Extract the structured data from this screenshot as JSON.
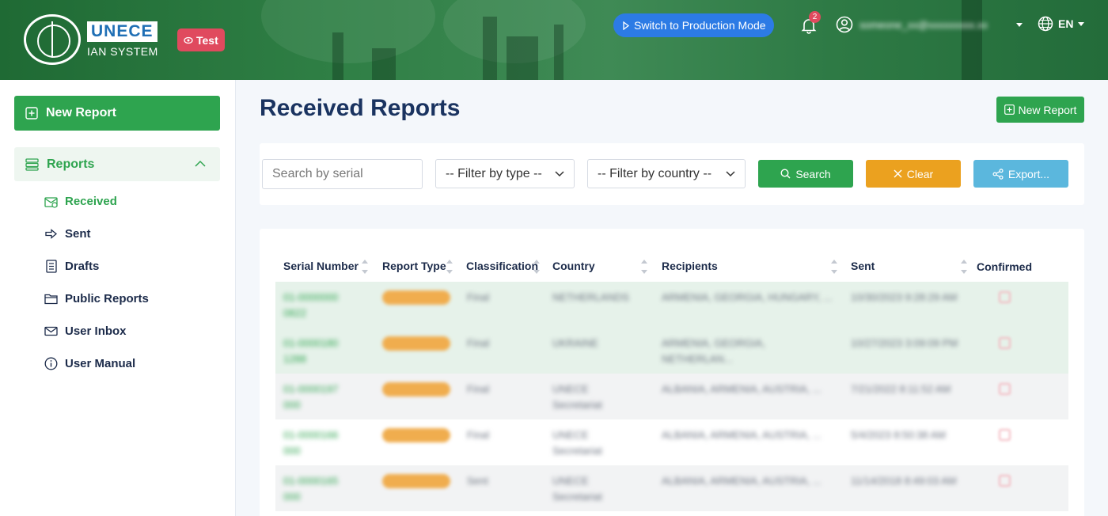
{
  "header": {
    "logo_unece": "UNECE",
    "logo_ian": "IAN SYSTEM",
    "test_badge": "Test",
    "prod_button": "Switch to Production Mode",
    "notifications_count": "2",
    "user_email": "someone_xx@xxxxxxxxx.xx",
    "language": "EN"
  },
  "sidebar": {
    "new_report": "New Report",
    "reports_group": "Reports",
    "items": [
      {
        "label": "Received",
        "icon": "envelope-open-icon"
      },
      {
        "label": "Sent",
        "icon": "arrow-right-icon"
      },
      {
        "label": "Drafts",
        "icon": "drafts-icon"
      },
      {
        "label": "Public Reports",
        "icon": "folder-icon"
      },
      {
        "label": "User Inbox",
        "icon": "envelope-icon"
      },
      {
        "label": "User Manual",
        "icon": "info-icon"
      }
    ]
  },
  "main": {
    "title": "Received Reports",
    "new_report": "New Report",
    "filters": {
      "search_placeholder": "Search by serial",
      "type_select": "-- Filter by type --",
      "country_select": "-- Filter by country --",
      "search_btn": "Search",
      "clear_btn": "Clear",
      "export_btn": "Export..."
    },
    "table": {
      "headers": [
        "Serial Number",
        "Report Type",
        "Classification",
        "Country",
        "Recipients",
        "Sent",
        "Confirmed"
      ],
      "rows": [
        {
          "serial": "01-0000000 0822",
          "classification": "Final",
          "country": "NETHERLANDS",
          "recipients": "ARMENIA, GEORGIA, HUNGARY, ...",
          "sent": "10/30/2023 9:28:29 AM"
        },
        {
          "serial": "01-0000180 1288",
          "classification": "Final",
          "country": "UKRAINE",
          "recipients": "ARMENIA, GEORGIA, NETHERLAN...",
          "sent": "10/27/2023 3:09:09 PM"
        },
        {
          "serial": "01-0000197 000",
          "classification": "Final",
          "country": "UNECE Secretariat",
          "recipients": "ALBANIA, ARMENIA, AUSTRIA, ...",
          "sent": "7/21/2022 8:11:52 AM"
        },
        {
          "serial": "01-0000166 000",
          "classification": "Final",
          "country": "UNECE Secretariat",
          "recipients": "ALBANIA, ARMENIA, AUSTRIA, ...",
          "sent": "5/4/2023 8:50:38 AM"
        },
        {
          "serial": "01-0000165 000",
          "classification": "Sent",
          "country": "UNECE Secretariat",
          "recipients": "ALBANIA, ARMENIA, AUSTRIA, ...",
          "sent": "11/14/2018 8:49:03 AM"
        }
      ]
    }
  },
  "colors": {
    "accent_green": "#2ea44f",
    "primary_blue": "#2c7be5",
    "warning_orange": "#eba11f",
    "info_cyan": "#5bb7dd",
    "danger_red": "#e04a5e",
    "title_navy": "#1a3360"
  }
}
